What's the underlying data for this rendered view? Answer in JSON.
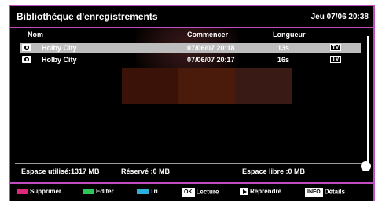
{
  "header": {
    "title": "Bibliothèque d'enregistrements",
    "clock": "Jeu 07/06 20:38"
  },
  "columns": {
    "name": "Nom",
    "start": "Commencer",
    "length": "Longueur"
  },
  "recordings": [
    {
      "name": "Holby City",
      "start": "07/06/07  20:18",
      "length": "13s",
      "badge": "TV",
      "selected": true
    },
    {
      "name": "Holby City",
      "start": "07/06/07  20:17",
      "length": "16s",
      "badge": "TV",
      "selected": false
    }
  ],
  "space": {
    "used": "Espace utilisé:1317 MB",
    "reserved": "Réservé :0 MB",
    "free": "Espace libre :0 MB"
  },
  "keys": {
    "red": {
      "label": "Supprimer",
      "color": "#e0287a"
    },
    "green": {
      "label": "Editer",
      "color": "#2ec65a"
    },
    "blue": {
      "label": "Tri",
      "color": "#2fb0d8"
    },
    "ok": {
      "button": "OK",
      "label": "Lecture"
    },
    "play": {
      "label": "Reprendre"
    },
    "info": {
      "button": "INFO",
      "label": "Détails"
    }
  },
  "colors": {
    "frame": "#c04cc0",
    "selected_row": "#bdbdbd"
  }
}
